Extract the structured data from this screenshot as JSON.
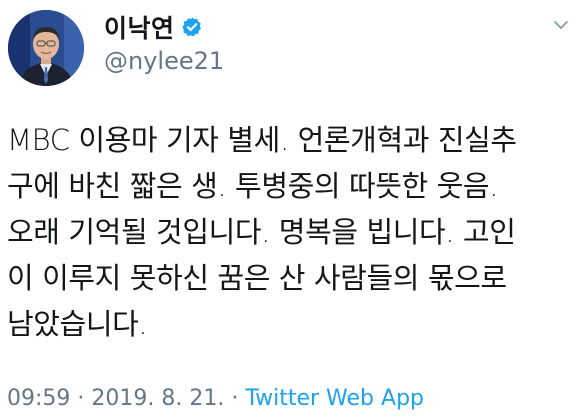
{
  "author": {
    "display_name": "이낙연",
    "handle": "@nylee21",
    "verified_icon": "verified-badge-icon",
    "avatar_icon": "profile-photo"
  },
  "menu": {
    "icon": "chevron-down-icon"
  },
  "tweet": {
    "lines": [
      "MBC 이용마 기자 별세. 언론개혁과 진실추",
      "구에 바친 짧은 생. 투병중의 따뜻한 웃음.",
      "오래 기억될 것입니다. 명복을 빕니다. 고인",
      "이 이루지 못하신 꿈은 산 사람들의 몫으로",
      "남았습니다."
    ]
  },
  "meta": {
    "time": "09:59",
    "separator": " · ",
    "date": "2019. 8. 21.",
    "source": "Twitter Web App"
  },
  "colors": {
    "text": "#14171a",
    "secondary": "#657786",
    "link": "#1da1f2",
    "verified": "#1da1f2"
  }
}
